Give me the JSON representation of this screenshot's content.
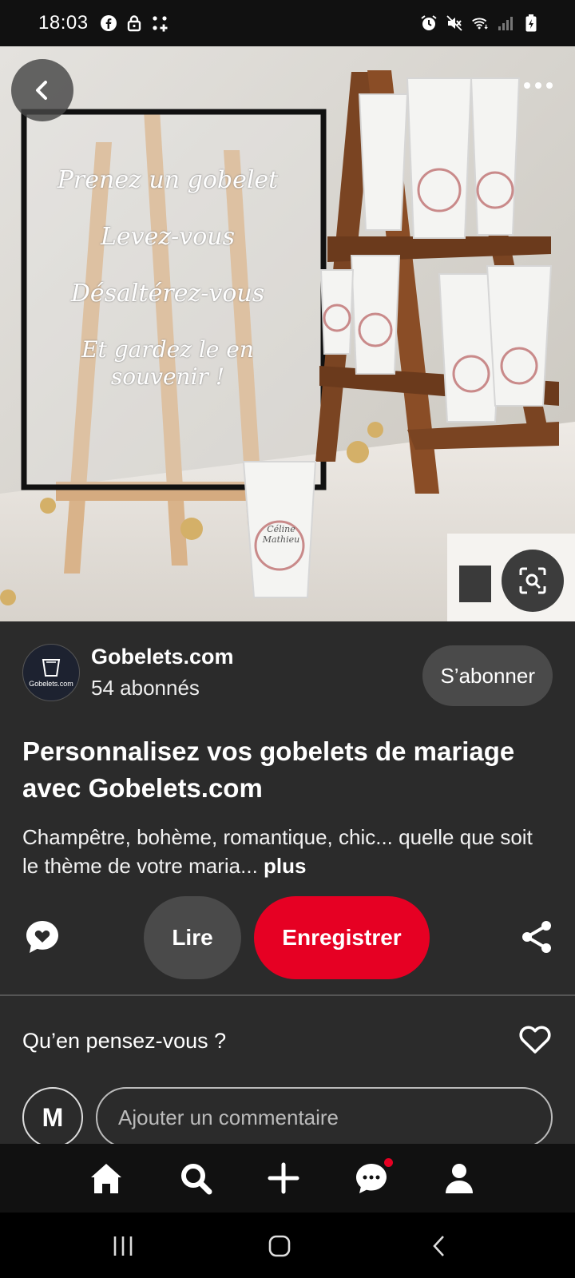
{
  "status_bar": {
    "time": "18:03",
    "left_icons": [
      "facebook-icon",
      "lock-icon",
      "apps-icon"
    ],
    "right_icons": [
      "alarm-icon",
      "mute-icon",
      "wifi-icon",
      "signal-icon",
      "battery-icon"
    ]
  },
  "hero": {
    "sign_lines": [
      "Prenez un gobelet",
      "Levez-vous",
      "Désaltérez-vous",
      "Et gardez le en souvenir !"
    ],
    "cup_print": [
      "Céline",
      "Mathieu"
    ]
  },
  "creator": {
    "avatar_logo_text": "Gobelets.com",
    "name": "Gobelets.com",
    "followers": "54 abonnés",
    "follow_label": "S’abonner"
  },
  "pin": {
    "title": "Personnalisez vos gobelets de mariage avec Gobelets.com",
    "description": "Champêtre, bohème, romantique, chic... quelle que soit le thème de votre maria...",
    "more_label": "plus"
  },
  "actions": {
    "read_label": "Lire",
    "save_label": "Enregistrer",
    "save_color": "#e60023"
  },
  "comments": {
    "prompt": "Qu’en pensez-vous ?",
    "user_initial": "M",
    "placeholder": "Ajouter un commentaire"
  },
  "bottom_nav": {
    "items": [
      "home-icon",
      "search-icon",
      "plus-icon",
      "messages-icon",
      "profile-icon"
    ],
    "messages_has_notification": true
  }
}
